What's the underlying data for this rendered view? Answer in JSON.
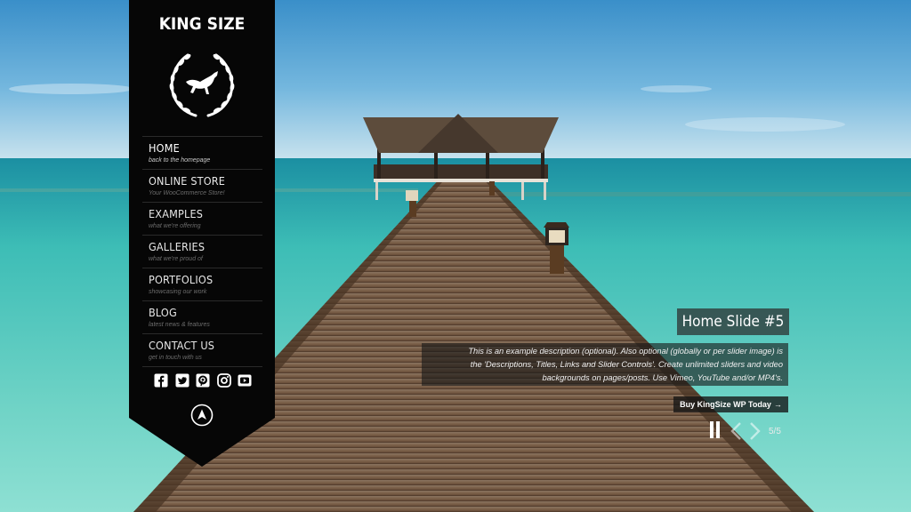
{
  "site": {
    "title": "KING SIZE"
  },
  "menu": [
    {
      "label": "HOME",
      "sub": "back to the homepage",
      "active": true
    },
    {
      "label": "ONLINE STORE",
      "sub": "Your WooCommerce Store!"
    },
    {
      "label": "EXAMPLES",
      "sub": "what we're offering"
    },
    {
      "label": "GALLERIES",
      "sub": "what we're proud of"
    },
    {
      "label": "PORTFOLIOS",
      "sub": "showcasing our work"
    },
    {
      "label": "BLOG",
      "sub": "latest news & features"
    },
    {
      "label": "CONTACT US",
      "sub": "get in touch with us"
    }
  ],
  "social": [
    "facebook-icon",
    "twitter-icon",
    "pinterest-icon",
    "instagram-icon",
    "youtube-icon"
  ],
  "slide": {
    "title": "Home Slide #5",
    "description_lines": [
      "This is an example description (optional). Also optional (globally or per slider image) is",
      "the 'Descriptions, Titles, Links and Slider Controls'. Create unlimited sliders and video",
      "backgrounds on pages/posts. Use Vimeo, YouTube and/or MP4's."
    ],
    "link_label": "Buy KingSize WP Today",
    "link_arrow": "→",
    "counter": "5/5"
  },
  "colors": {
    "panel": "#060606",
    "text": "#ffffff"
  }
}
